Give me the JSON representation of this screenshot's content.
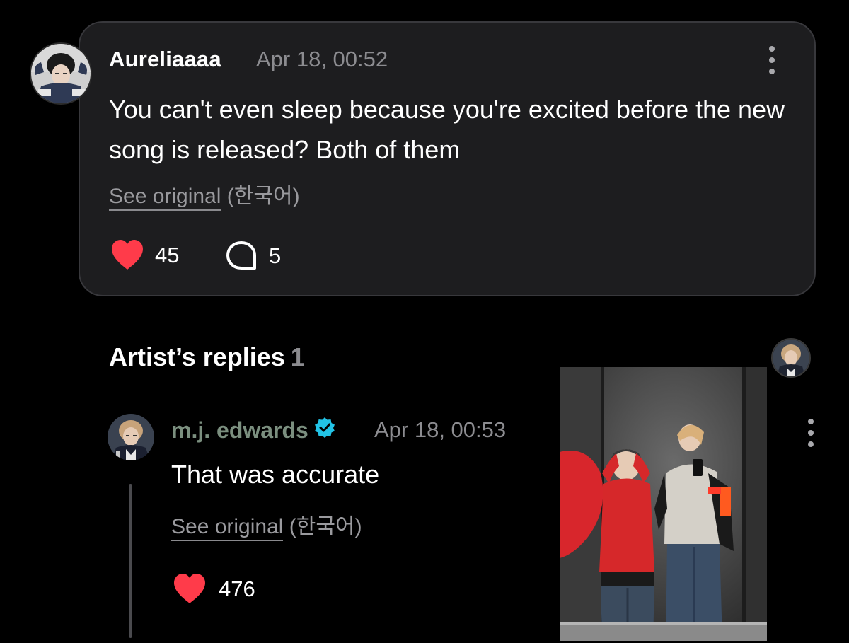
{
  "comment": {
    "username": "Aureliaaaa",
    "timestamp": "Apr 18, 00:52",
    "text": "You can't even sleep because you're excited before the new song is released? Both of them",
    "see_original_label": "See original",
    "language": "(한국어)",
    "likes": "45",
    "replies": "5",
    "avatar_icon": "user-avatar-photo",
    "like_icon": "heart-icon",
    "reply_icon": "speech-bubble-icon",
    "menu_icon": "more-vertical-icon"
  },
  "artist_replies": {
    "title": "Artist’s replies",
    "count": "1",
    "reply": {
      "username": "m.j. edwards",
      "verified_icon": "verified-badge-icon",
      "timestamp": "Apr 18, 00:53",
      "text": "That was accurate",
      "see_original_label": "See original",
      "language": "(한국어)",
      "likes": "476",
      "image": "mirror-selfie-photo"
    }
  },
  "colors": {
    "background": "#000000",
    "card_background": "#1d1d1f",
    "card_border": "#38383c",
    "heart": "#ff3b4a",
    "muted_text": "#8c8c90",
    "artist_name": "#7b8f7f",
    "verified_badge": "#22c3e6"
  }
}
